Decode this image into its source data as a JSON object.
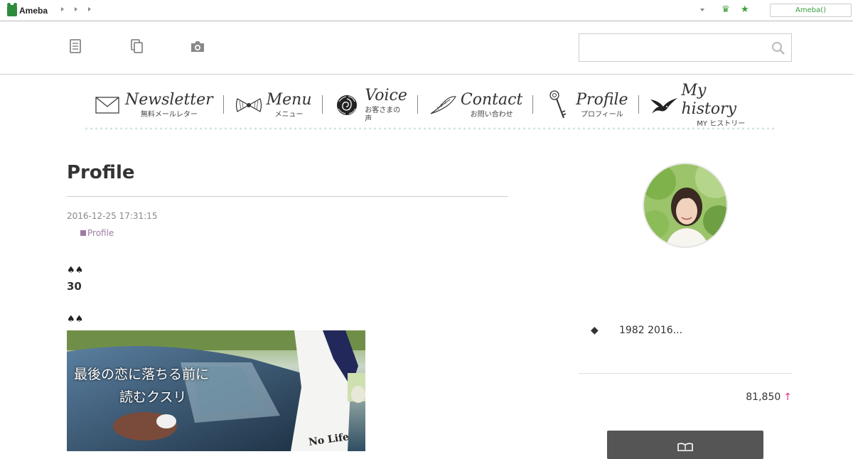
{
  "topbar": {
    "logo_text": "Ameba",
    "login_button": "Ameba()",
    "icons": [
      "arrow-right-icon",
      "arrow-right-icon",
      "arrow-right-icon",
      "dropdown-arrow-icon",
      "crown-icon",
      "star-icon"
    ],
    "accent": "#3a9e3a"
  },
  "header": {
    "icons": [
      "list-icon",
      "copy-icon",
      "camera-icon"
    ],
    "search": {
      "value": "",
      "placeholder": ""
    }
  },
  "nav": {
    "items": [
      {
        "en": "Newsletter",
        "ja": "無料メールレター",
        "icon": "envelope-icon"
      },
      {
        "en": "Menu",
        "ja": "メニュー",
        "icon": "bow-icon"
      },
      {
        "en": "Voice",
        "ja": "お客さまの声",
        "icon": "rose-icon"
      },
      {
        "en": "Contact",
        "ja": "お問い合わせ",
        "icon": "feather-pen-icon"
      },
      {
        "en": "Profile",
        "ja": "プロフィール",
        "icon": "key-icon"
      },
      {
        "en": "My history",
        "ja": "MY ヒストリー",
        "icon": "swallow-bird-icon"
      }
    ]
  },
  "article": {
    "title": "Profile",
    "date": "2016-12-25 17:31:15",
    "category": "Profile",
    "spades_1": "♠♠",
    "heading_30": "30",
    "spades_2": "♠♠",
    "book_title_line1": "最後の恋に落ちる前に",
    "book_title_line2": "読むクスリ",
    "book_corner_text": "No Life",
    "category_color": "#a07aa5"
  },
  "sidebar": {
    "description_bullet": "◆",
    "description": "1982 2016...",
    "counter_value": "81,850",
    "counter_arrow": "↑",
    "counter_arrow_color": "#e0307a"
  }
}
